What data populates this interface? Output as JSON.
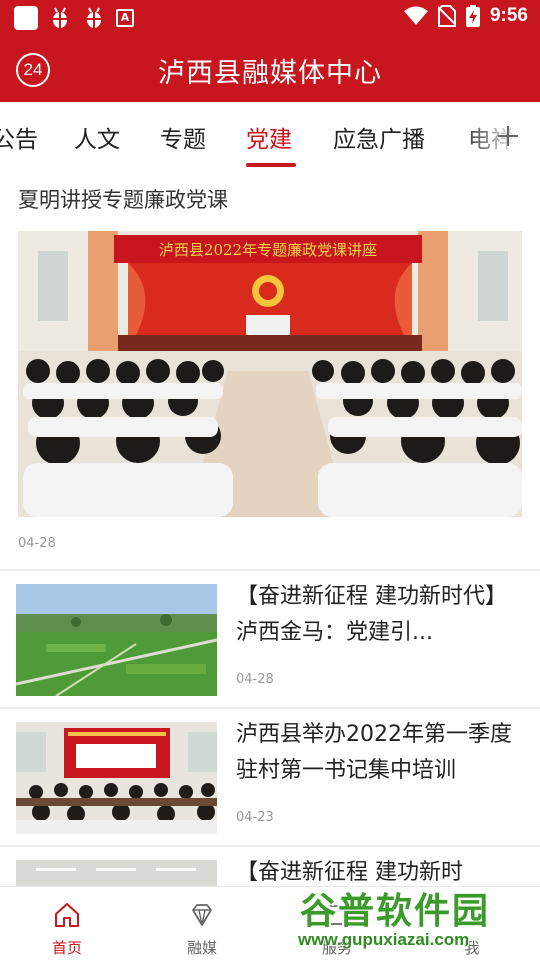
{
  "status_bar": {
    "time": "9:56",
    "left_icons": [
      "app-square-icon",
      "bug-icon",
      "bug-icon",
      "a-box-icon"
    ],
    "right_icons": [
      "wifi-icon",
      "no-sim-icon",
      "battery-charging-icon"
    ]
  },
  "header": {
    "logo_text": "24",
    "title": "泸西县融媒体中心",
    "bg_color": "#c8161e"
  },
  "tabs": [
    {
      "label": "公告",
      "active": false
    },
    {
      "label": "人文",
      "active": false
    },
    {
      "label": "专题",
      "active": false
    },
    {
      "label": "党建",
      "active": true
    },
    {
      "label": "应急广播",
      "active": false
    },
    {
      "label": "电祥",
      "active": false
    }
  ],
  "tab_more_icon": "plus-icon",
  "featured": {
    "title": "夏明讲授专题廉政党课",
    "banner_text": "泸西县2022年专题廉政党课讲座",
    "date": "04-28"
  },
  "news": [
    {
      "title": "【奋进新征程 建功新时代】泸西金马：党建引...",
      "date": "04-28",
      "thumb": "green-fields"
    },
    {
      "title": "泸西县举办2022年第一季度驻村第一书记集中培训",
      "date": "04-23",
      "thumb": "meeting-room"
    },
    {
      "title": "【奋进新征程 建功新时",
      "date": "",
      "thumb": "hall"
    }
  ],
  "bottom_nav": [
    {
      "label": "首页",
      "icon": "home-icon",
      "active": true
    },
    {
      "label": "融媒",
      "icon": "diamond-icon",
      "active": false
    },
    {
      "label": "服务",
      "icon": "service-icon",
      "active": false
    },
    {
      "label": "我",
      "icon": "profile-icon",
      "active": false
    }
  ],
  "watermark": {
    "cn": "谷普软件园",
    "url": "www.gupuxiazai.com"
  }
}
